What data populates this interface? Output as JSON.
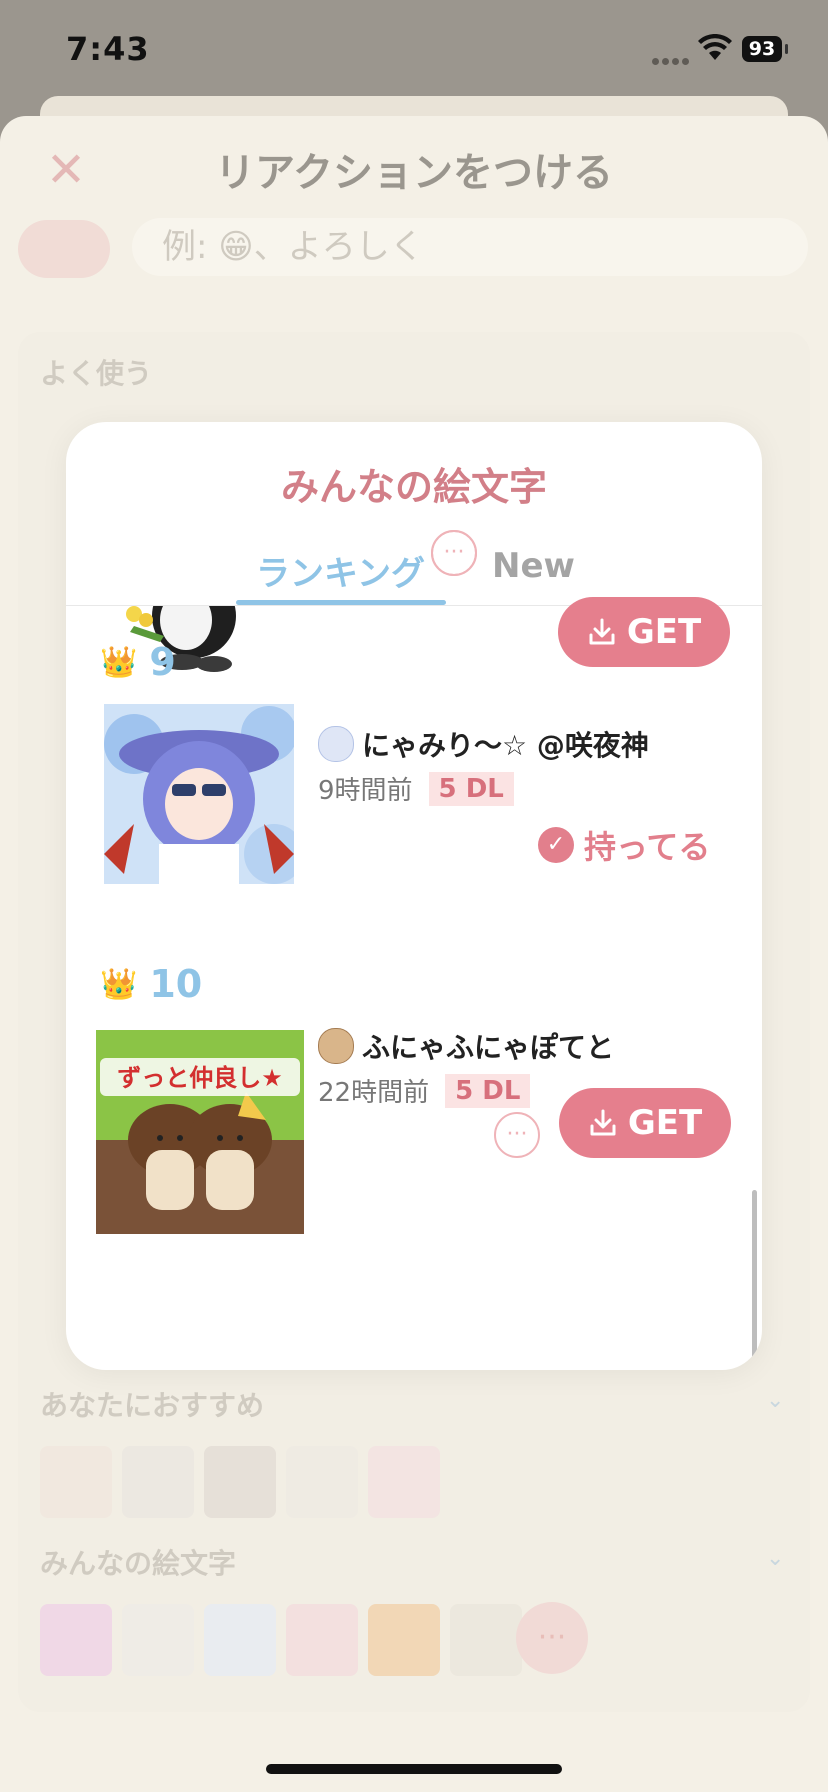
{
  "status": {
    "time": "7:43",
    "battery": "93"
  },
  "sheet": {
    "title": "リアクションをつける",
    "close_glyph": "✕",
    "search_placeholder": "例: 😁、よろしく",
    "sections": {
      "frequent": "よく使う",
      "recommended": "あなたにおすすめ",
      "everyone": "みんなの絵文字"
    },
    "more_glyph": "···"
  },
  "modal": {
    "title": "みんなの絵文字",
    "tabs": [
      "ランキング",
      "New"
    ],
    "active_tab": "ランキング",
    "get_label": "GET",
    "more_glyph": "···",
    "items": [
      {
        "rank": "9",
        "author": "にゃみり〜☆ @咲夜神",
        "time": "9時間前",
        "downloads": "5 DL",
        "owned_label": "持ってる",
        "owned_glyph": "✓"
      },
      {
        "rank": "10",
        "author": "ふにゃふにゃぽてと",
        "time": "22時間前",
        "downloads": "5 DL",
        "image_caption": "ずっと仲良し★"
      }
    ]
  },
  "colors": {
    "accent_pink": "#e57f8d",
    "accent_blue": "#8fc4e6",
    "title_pink": "#d27f88"
  }
}
